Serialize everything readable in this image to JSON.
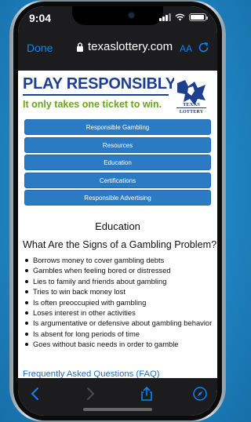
{
  "status": {
    "time": "9:04"
  },
  "safari": {
    "done_label": "Done",
    "url": "texaslottery.com",
    "text_size_label": "AA"
  },
  "banner": {
    "title": "PLAY RESPONSIBLY",
    "subtitle": "It only takes one ticket to win.",
    "logo_text_top": "TEXAS",
    "logo_text_bottom": "LOTTERY"
  },
  "menu": {
    "items": [
      {
        "label": "Responsible Gambling"
      },
      {
        "label": "Resources"
      },
      {
        "label": "Education"
      },
      {
        "label": "Certifications"
      },
      {
        "label": "Responsible Advertising"
      }
    ]
  },
  "page": {
    "heading": "Education",
    "section_heading": "What Are the Signs of a Gambling Problem?",
    "signs": [
      "Borrows money to cover gambling debts",
      "Gambles when feeling bored or distressed",
      "Lies to family and friends about gambling",
      "Tries to win back money lost",
      "Is often preoccupied with gambling",
      "Loses interest in other activities",
      "Is argumentative or defensive about gambling behavior",
      "Is absent for long periods of time",
      "Goes without basic needs in order to gamble"
    ],
    "faq_link": "Frequently Asked Questions (FAQ)"
  },
  "toolbar": {
    "back_icon": "chevron-left-icon",
    "forward_icon": "chevron-right-icon",
    "share_icon": "share-icon",
    "compass_icon": "compass-icon"
  },
  "colors": {
    "background_blue": "#1f86c4",
    "menu_blue": "#2a7ac4",
    "banner_blue": "#1d3f8f",
    "banner_green": "#6aa520",
    "link_blue": "#1f6fc0",
    "safari_blue": "#0a84ff"
  }
}
